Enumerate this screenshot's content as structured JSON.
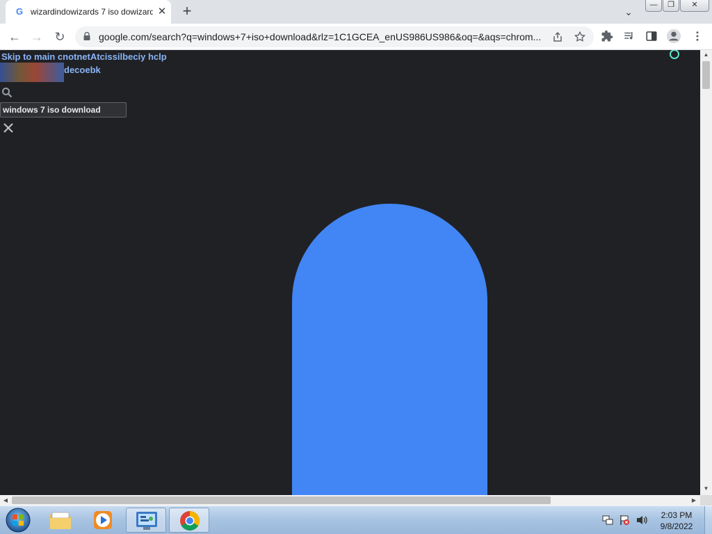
{
  "browser": {
    "tab": {
      "favicon": "G",
      "title": "wizardindowizards 7 iso dowizard",
      "close": "✕"
    },
    "new_tab": "+",
    "tab_search": "⌄",
    "window_controls": {
      "minimize": "—",
      "maximize": "❐",
      "close": "✕"
    },
    "toolbar": {
      "back": "←",
      "forward": "→",
      "reload": "↻"
    },
    "omnibox": {
      "url": "google.com/search?q=windows+7+iso+download&rlz=1C1GCEA_enUS986US986&oq=&aqs=chrom..."
    },
    "icons": [
      "lock-icon",
      "share-icon",
      "star-icon",
      "extensions-icon",
      "media-icon",
      "side-panel-icon",
      "profile-icon",
      "menu-icon"
    ]
  },
  "page": {
    "skip_links": "Skip to main cnotnetAtcissilbeciy hclp",
    "logo_text": "decoebk",
    "search": {
      "value": "windows 7 iso download"
    },
    "loading_shape_color": "#4285f4",
    "spinner_color": "#5ee6c9"
  },
  "taskbar": {
    "apps": [
      "windows-explorer",
      "windows-media-player",
      "control-panel",
      "google-chrome"
    ],
    "clock": {
      "time": "2:03 PM",
      "date": "9/8/2022"
    }
  },
  "colors": {
    "page_bg": "#202124",
    "accent": "#4285f4",
    "link": "#8ab4f8"
  }
}
